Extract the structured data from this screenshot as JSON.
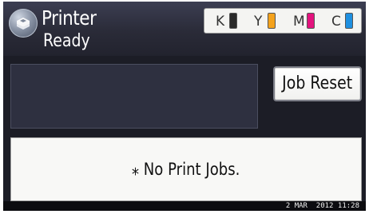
{
  "header": {
    "title": "Printer",
    "status": "Ready",
    "icon": "printer-app-icon"
  },
  "toner": [
    {
      "letter": "K",
      "color": "#2a2a2a"
    },
    {
      "letter": "Y",
      "color": "#f4a21c"
    },
    {
      "letter": "M",
      "color": "#e3137e"
    },
    {
      "letter": "C",
      "color": "#1e8fe0"
    }
  ],
  "job_reset_label": "Job Reset",
  "job_list": {
    "empty_message": "⁎ No Print Jobs."
  },
  "footer": {
    "datetime": "2 MAR  2012 11:28"
  }
}
